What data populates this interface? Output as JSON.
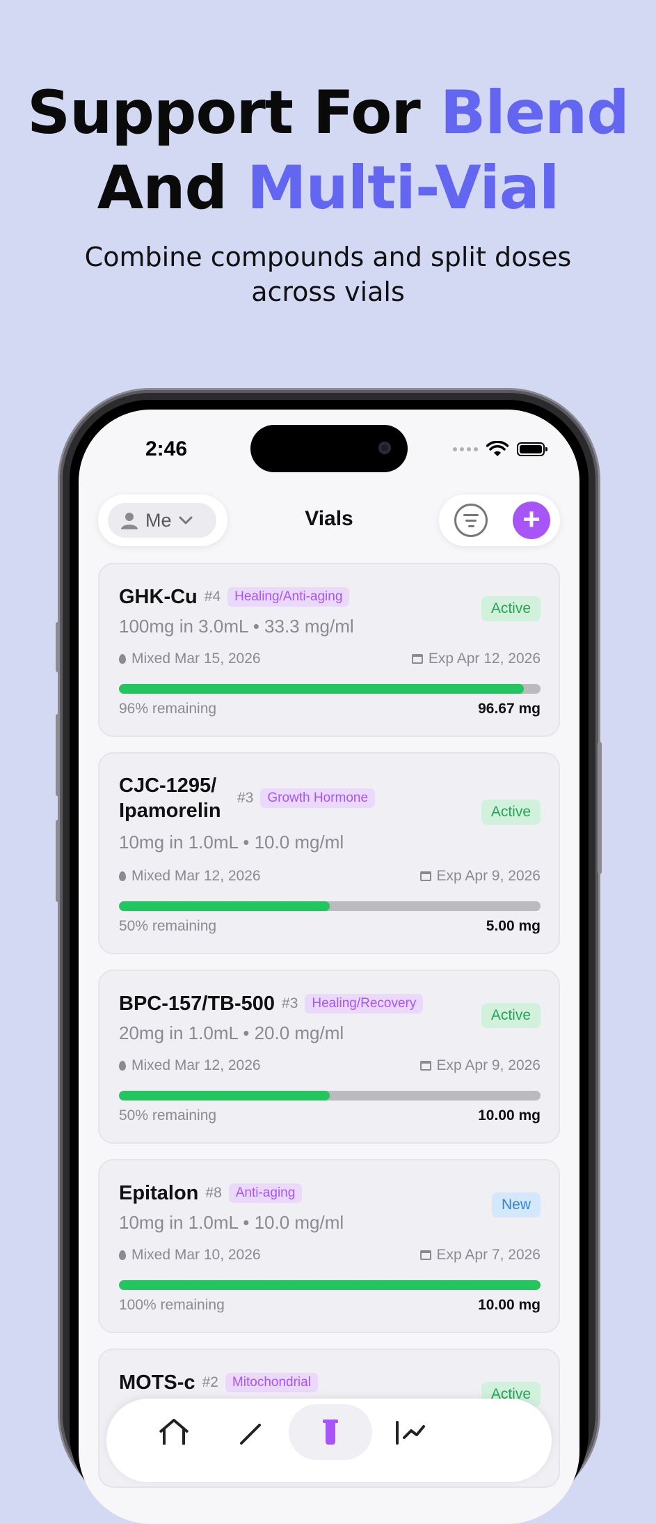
{
  "hero": {
    "line1_plain": "Support For ",
    "line1_accent": "Blend",
    "line2_plain": "And ",
    "line2_accent": "Multi-Vial",
    "subtitle": "Combine compounds and split doses across vials",
    "accent_color": "#6366f1"
  },
  "status_bar": {
    "time": "2:46"
  },
  "nav": {
    "profile_label": "Me",
    "title": "Vials",
    "filter_icon": "filter-icon",
    "add_icon": "plus-icon",
    "add_label": "+",
    "add_color": "#a855f7"
  },
  "vials": [
    {
      "name": "GHK-Cu",
      "number": "#4",
      "category": "Healing/Anti-aging",
      "status": "Active",
      "concentration": "100mg in 3.0mL • 33.3 mg/ml",
      "mixed": "Mixed Mar 15, 2026",
      "expires": "Exp Apr 12, 2026",
      "remaining_fraction": 0.96,
      "remaining_text": "96% remaining",
      "amount": "96.67 mg"
    },
    {
      "name": "CJC-1295/ Ipamorelin",
      "number": "#3",
      "category": "Growth Hormone",
      "status": "Active",
      "concentration": "10mg in 1.0mL • 10.0 mg/ml",
      "mixed": "Mixed Mar 12, 2026",
      "expires": "Exp Apr 9, 2026",
      "remaining_fraction": 0.5,
      "remaining_text": "50% remaining",
      "amount": "5.00 mg"
    },
    {
      "name": "BPC-157/TB-500",
      "number": "#3",
      "category": "Healing/Recovery",
      "status": "Active",
      "concentration": "20mg in 1.0mL • 20.0 mg/ml",
      "mixed": "Mixed Mar 12, 2026",
      "expires": "Exp Apr 9, 2026",
      "remaining_fraction": 0.5,
      "remaining_text": "50% remaining",
      "amount": "10.00 mg"
    },
    {
      "name": "Epitalon",
      "number": "#8",
      "category": "Anti-aging",
      "status": "New",
      "concentration": "10mg in 1.0mL • 10.0 mg/ml",
      "mixed": "Mixed Mar 10, 2026",
      "expires": "Exp Apr 7, 2026",
      "remaining_fraction": 1.0,
      "remaining_text": "100% remaining",
      "amount": "10.00 mg"
    },
    {
      "name": "MOTS-c",
      "number": "#2",
      "category": "Mitochondrial",
      "status": "Active"
    }
  ],
  "tabbar": {
    "tabs": [
      "home-icon",
      "edit-icon",
      "vial-icon",
      "chart-icon"
    ],
    "active_tab": "vial-icon"
  }
}
